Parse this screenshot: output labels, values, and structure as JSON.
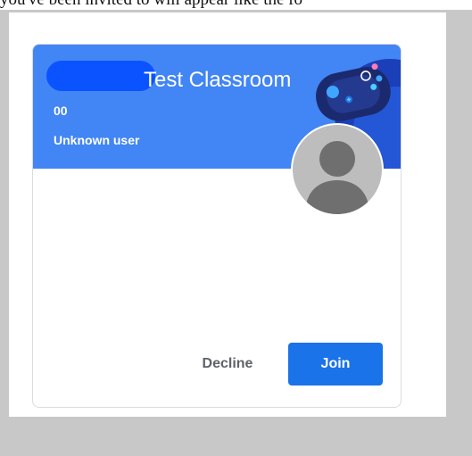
{
  "caption": "you've been invited to will appear like the fo",
  "card": {
    "class_name": "Test Classroom",
    "section": "00",
    "teacher": "Unknown user",
    "header_color": "#4285f4",
    "redaction_color": "#0a53ff",
    "avatar_icon": "person-avatar-icon",
    "banner_icon": "gamepad-icon"
  },
  "actions": {
    "decline_label": "Decline",
    "join_label": "Join",
    "join_color": "#1a73e8"
  }
}
